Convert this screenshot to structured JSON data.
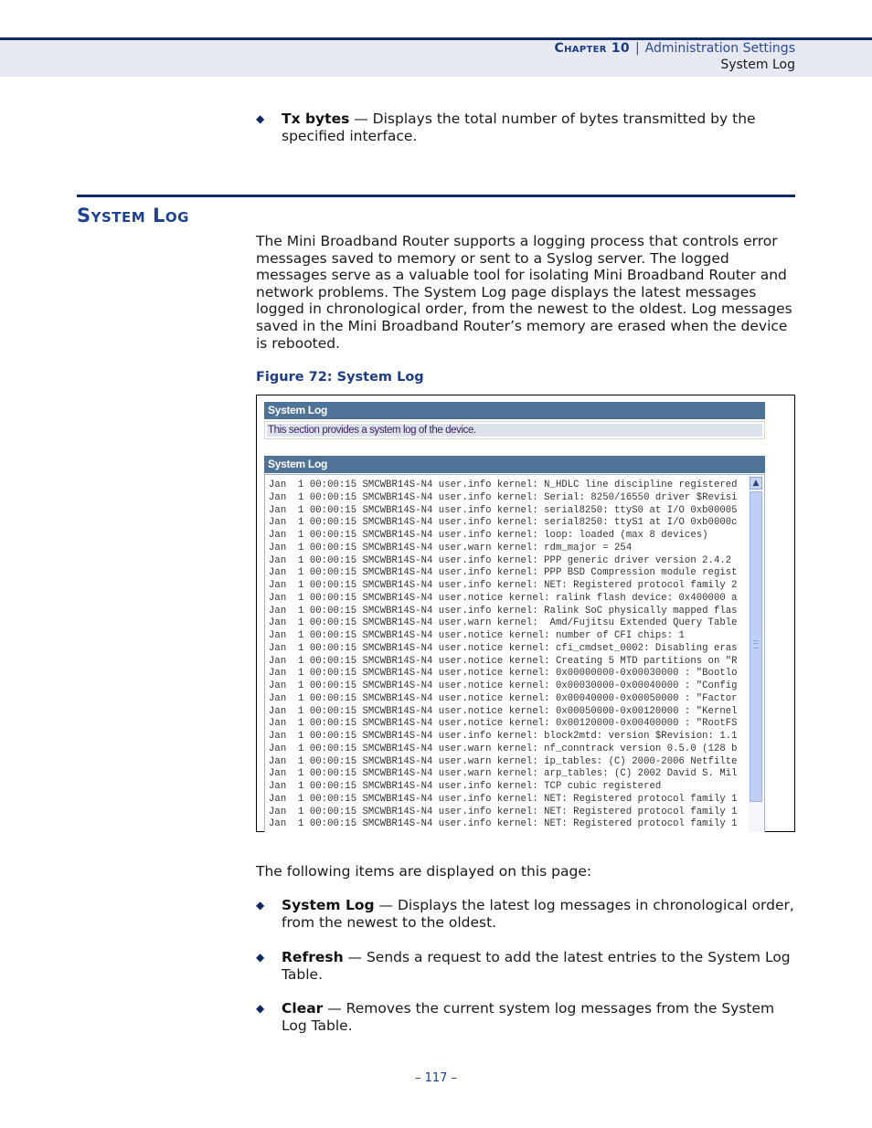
{
  "header": {
    "chapter": "Chapter 10",
    "separator": "|",
    "chapter_title": "Administration Settings",
    "section": "System Log"
  },
  "top_bullet": {
    "term": "Tx bytes",
    "description": " — Displays the total number of bytes transmitted by the specified interface."
  },
  "section": {
    "title": "System Log",
    "intro": "The Mini Broadband Router supports a logging process that controls error messages saved to memory or sent to a Syslog server. The logged messages serve as a valuable tool for isolating Mini Broadband Router and network problems. The System Log page displays the latest messages logged in chronological order, from the newest to the oldest. Log messages saved in the Mini Broadband Router’s memory are erased when the device is rebooted."
  },
  "figure": {
    "caption": "Figure 72:  System Log",
    "panel1_title": "System Log",
    "panel1_desc": "This section provides a system log of the device.",
    "panel2_title": "System Log",
    "log_lines": [
      "Jan  1 00:00:15 SMCWBR14S-N4 user.info kernel: N_HDLC line discipline registered",
      "Jan  1 00:00:15 SMCWBR14S-N4 user.info kernel: Serial: 8250/16550 driver $Revisi",
      "Jan  1 00:00:15 SMCWBR14S-N4 user.info kernel: serial8250: ttyS0 at I/O 0xb00005",
      "Jan  1 00:00:15 SMCWBR14S-N4 user.info kernel: serial8250: ttyS1 at I/O 0xb0000c",
      "Jan  1 00:00:15 SMCWBR14S-N4 user.info kernel: loop: loaded (max 8 devices)",
      "Jan  1 00:00:15 SMCWBR14S-N4 user.warn kernel: rdm_major = 254",
      "Jan  1 00:00:15 SMCWBR14S-N4 user.info kernel: PPP generic driver version 2.4.2",
      "Jan  1 00:00:15 SMCWBR14S-N4 user.info kernel: PPP BSD Compression module regist",
      "Jan  1 00:00:15 SMCWBR14S-N4 user.info kernel: NET: Registered protocol family 2",
      "Jan  1 00:00:15 SMCWBR14S-N4 user.notice kernel: ralink flash device: 0x400000 a",
      "Jan  1 00:00:15 SMCWBR14S-N4 user.info kernel: Ralink SoC physically mapped flas",
      "Jan  1 00:00:15 SMCWBR14S-N4 user.warn kernel:  Amd/Fujitsu Extended Query Table",
      "Jan  1 00:00:15 SMCWBR14S-N4 user.notice kernel: number of CFI chips: 1",
      "Jan  1 00:00:15 SMCWBR14S-N4 user.notice kernel: cfi_cmdset_0002: Disabling eras",
      "Jan  1 00:00:15 SMCWBR14S-N4 user.notice kernel: Creating 5 MTD partitions on \"R",
      "Jan  1 00:00:15 SMCWBR14S-N4 user.notice kernel: 0x00000000-0x00030000 : \"Bootlo",
      "Jan  1 00:00:15 SMCWBR14S-N4 user.notice kernel: 0x00030000-0x00040000 : \"Config",
      "Jan  1 00:00:15 SMCWBR14S-N4 user.notice kernel: 0x00040000-0x00050000 : \"Factor",
      "Jan  1 00:00:15 SMCWBR14S-N4 user.notice kernel: 0x00050000-0x00120000 : \"Kernel",
      "Jan  1 00:00:15 SMCWBR14S-N4 user.notice kernel: 0x00120000-0x00400000 : \"RootFS",
      "Jan  1 00:00:15 SMCWBR14S-N4 user.info kernel: block2mtd: version $Revision: 1.1",
      "Jan  1 00:00:15 SMCWBR14S-N4 user.warn kernel: nf_conntrack version 0.5.0 (128 b",
      "Jan  1 00:00:15 SMCWBR14S-N4 user.warn kernel: ip_tables: (C) 2000-2006 Netfilte",
      "Jan  1 00:00:15 SMCWBR14S-N4 user.warn kernel: arp_tables: (C) 2002 David S. Mil",
      "Jan  1 00:00:15 SMCWBR14S-N4 user.info kernel: TCP cubic registered",
      "Jan  1 00:00:15 SMCWBR14S-N4 user.info kernel: NET: Registered protocol family 1",
      "Jan  1 00:00:15 SMCWBR14S-N4 user.info kernel: NET: Registered protocol family 1",
      "Jan  1 00:00:15 SMCWBR14S-N4 user.info kernel: NET: Registered protocol family 1"
    ],
    "scroll_up_icon": "▲"
  },
  "items_intro": "The following items are displayed on this page:",
  "items": [
    {
      "term": "System Log",
      "description": " — Displays the latest log messages in chronological order, from the newest to the oldest."
    },
    {
      "term": "Refresh",
      "description": " — Sends a request to add the latest entries to the System Log Table."
    },
    {
      "term": "Clear",
      "description": " — Removes the current system log messages from the System Log Table."
    }
  ],
  "bullet_glyph": "◆",
  "page_number": "–  117  –"
}
